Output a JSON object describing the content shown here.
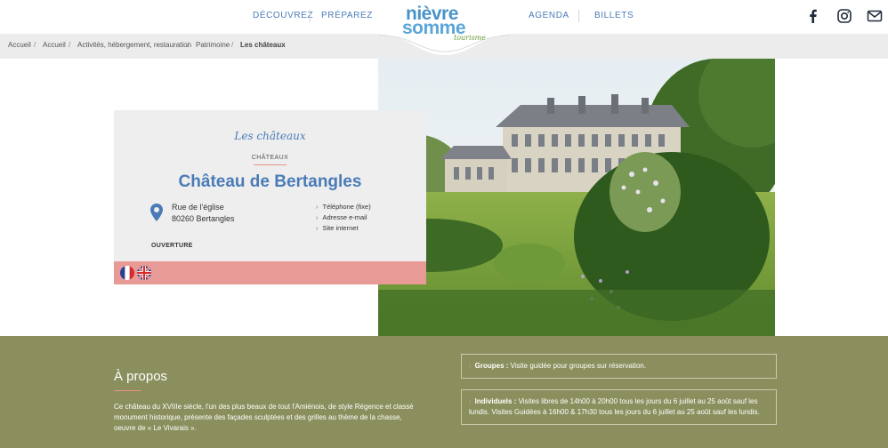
{
  "nav": {
    "left": [
      {
        "label": "DÉCOUVREZ"
      },
      {
        "label": "PRÉPAREZ"
      }
    ],
    "right": [
      {
        "label": "AGENDA"
      },
      {
        "label": "BILLETS"
      }
    ]
  },
  "logo": {
    "line1": "nièvre",
    "line2": "somme",
    "line3": "tourisme"
  },
  "social": [
    "facebook-icon",
    "instagram-icon",
    "mail-icon"
  ],
  "breadcrumb": {
    "items": [
      "Accueil",
      "Accueil",
      "Activités, hébergement, restauration",
      "Patrimoine"
    ],
    "current": "Les châteaux",
    "separator": "/"
  },
  "card": {
    "script_title": "Les châteaux",
    "type": "CHÂTEAUX",
    "title": "Château de Bertangles",
    "address_line1": "Rue de l'église",
    "address_line2": "80260 Bertangles",
    "contacts": [
      "Téléphone (fixe)",
      "Adresse e-mail",
      "Site internet"
    ],
    "opening_label": "OUVERTURE",
    "languages": [
      "fr-flag-icon",
      "uk-flag-icon"
    ]
  },
  "about": {
    "title": "À propos",
    "text": "Ce château du XVIIIe siècle, l'un des plus beaux de tout l'Amiénois, de style Régence et classé monument historique, présente des façades sculptées et des grilles au thème de la chasse, oeuvre de « Le Vivarais »."
  },
  "visits": {
    "groups_label": "Groupes :",
    "groups_text": " Visite guidée pour groupes sur réservation.",
    "individuals_label": "Individuels :",
    "individuals_text": " Visites libres de 14h00 à 20h00 tous les jours du 6 juillet au 25 août sauf les lundis. Visites Guidées à 16h00 & 17h30 tous les jours du 6 juillet au 25 août sauf les lundis."
  },
  "colors": {
    "brand_blue": "#4a7bb7",
    "accent_pink": "#e89a96",
    "olive": "#8b8f5d"
  }
}
